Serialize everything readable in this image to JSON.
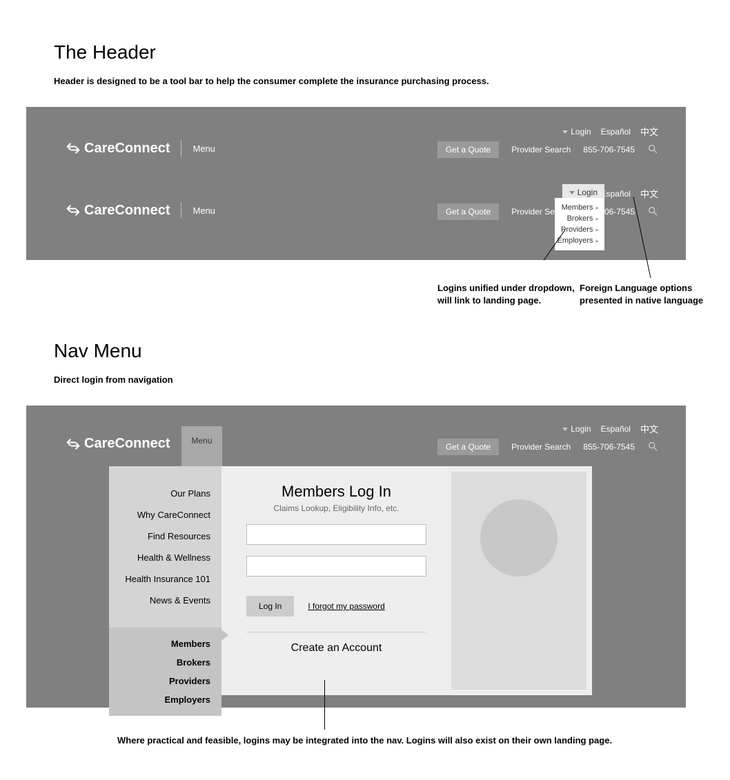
{
  "section1": {
    "title": "The Header",
    "desc": "Header is designed to be a tool bar to help the consumer complete the insurance purchasing process.",
    "logo": "CareConnect",
    "menu": "Menu",
    "quote": "Get a Quote",
    "provider_search": "Provider Search",
    "phone": "855-706-7545",
    "login": "Login",
    "espanol": "Español",
    "chinese": "中文",
    "dd": {
      "members": "Members",
      "brokers": "Brokers",
      "providers": "Providers",
      "employers": "Employers"
    },
    "annot1": "Logins unified under dropdown, will link to landing page.",
    "annot2": "Foreign Language options presented in native language"
  },
  "section2": {
    "title": "Nav Menu",
    "desc": "Direct login from navigation",
    "nav": {
      "our_plans": "Our Plans",
      "why": "Why CareConnect",
      "find": "Find Resources",
      "health": "Health & Wellness",
      "hi101": "Health Insurance 101",
      "news": "News & Events",
      "members": "Members",
      "brokers": "Brokers",
      "providers": "Providers",
      "employers": "Employers"
    },
    "login_panel": {
      "title": "Members Log In",
      "sub": "Claims Lookup, Eligibility Info, etc.",
      "login_btn": "Log In",
      "forgot": "I forgot my password",
      "create": "Create an Account"
    },
    "foot_annot": "Where practical and feasible, logins may be integrated into the nav. Logins will also exist on their own landing page."
  }
}
